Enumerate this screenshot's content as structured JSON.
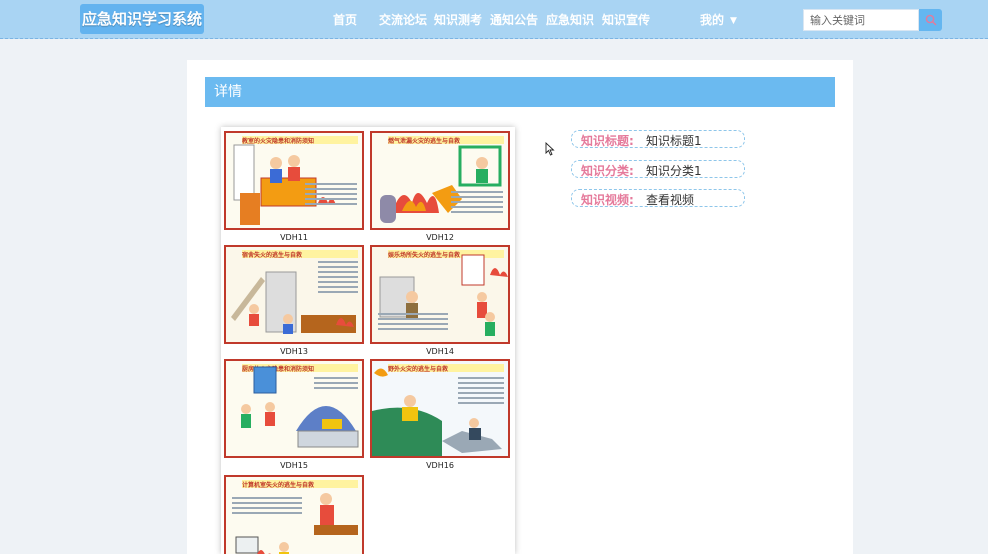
{
  "header": {
    "app_title": "应急知识学习系统",
    "nav": [
      "首页",
      "交流论坛",
      "知识测考",
      "通知公告",
      "应急知识",
      "知识宣传"
    ],
    "user_menu": "我的",
    "search": {
      "placeholder": "输入关键词",
      "value": ""
    }
  },
  "detail": {
    "heading": "详情",
    "poster": {
      "panels": [
        {
          "title": "教室的火灾隐患和消防须知",
          "caption": "VDH11"
        },
        {
          "title": "燃气泄漏火灾的逃生与自救",
          "caption": "VDH12"
        },
        {
          "title": "宿舍失火的逃生与自救",
          "caption": "VDH13"
        },
        {
          "title": "娱乐场所失火的逃生与自救",
          "caption": "VDH14"
        },
        {
          "title": "厨房的火灾隐患和消防须知",
          "caption": "VDH15"
        },
        {
          "title": "野外火灾的逃生与自救",
          "caption": "VDH16"
        },
        {
          "title": "计算机室失火的逃生与自救",
          "caption": ""
        }
      ]
    },
    "info": [
      {
        "label": "知识标题:",
        "value": "知识标题1"
      },
      {
        "label": "知识分类:",
        "value": "知识分类1"
      },
      {
        "label": "知识视频:",
        "value": "查看视频"
      }
    ]
  },
  "colors": {
    "header_bg": "#a9d4f3",
    "accent": "#6bbaf0",
    "label_pink": "#e57a9b",
    "poster_red": "#c0392b"
  }
}
